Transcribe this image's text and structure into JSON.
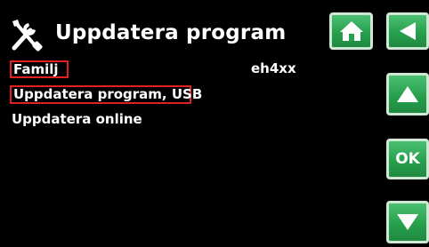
{
  "header": {
    "title": "Uppdatera program",
    "icon": "tools-icon"
  },
  "buttons": {
    "home_icon": "home-icon",
    "back_icon": "back-arrow-icon",
    "up_icon": "arrow-up-icon",
    "ok_label": "OK",
    "down_icon": "arrow-down-icon"
  },
  "menu": {
    "items": [
      {
        "label": "Familj",
        "value": "eh4xx"
      },
      {
        "label": "Uppdatera program, USB"
      },
      {
        "label": "Uppdatera online"
      }
    ]
  },
  "colors": {
    "button_green": "#27a04d",
    "highlight_red": "#e02020",
    "background": "#000000"
  }
}
